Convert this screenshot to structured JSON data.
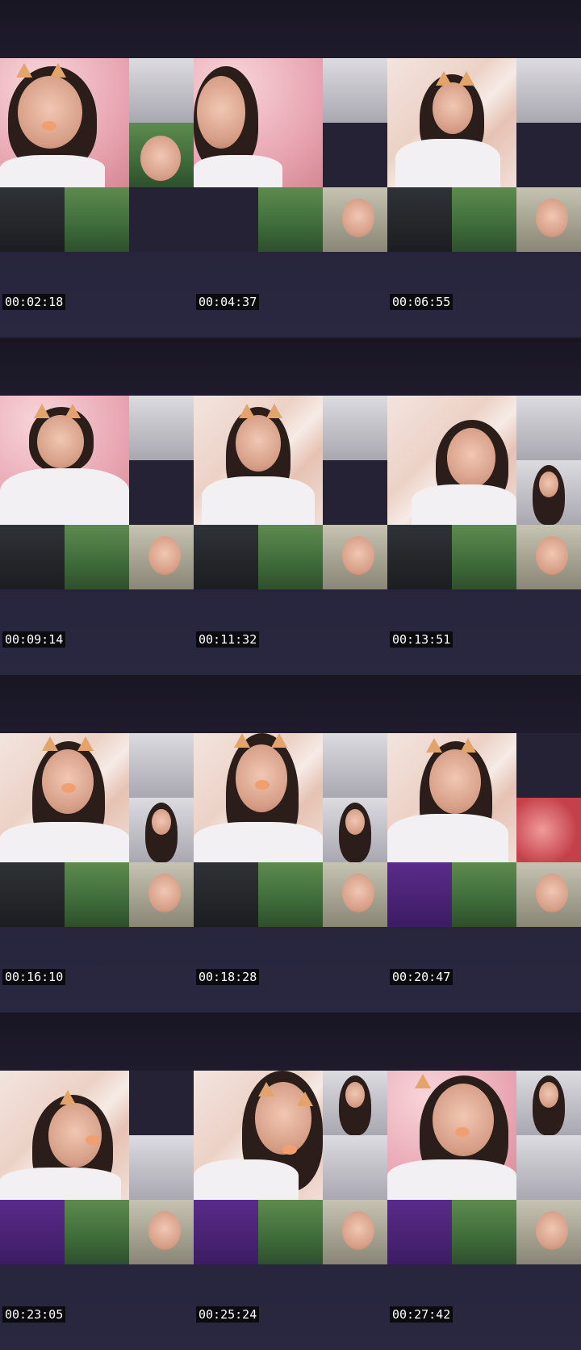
{
  "frames": [
    {
      "timestamp": "00:02:18"
    },
    {
      "timestamp": "00:04:37"
    },
    {
      "timestamp": "00:06:55"
    },
    {
      "timestamp": "00:09:14"
    },
    {
      "timestamp": "00:11:32"
    },
    {
      "timestamp": "00:13:51"
    },
    {
      "timestamp": "00:16:10"
    },
    {
      "timestamp": "00:18:28"
    },
    {
      "timestamp": "00:20:47"
    },
    {
      "timestamp": "00:23:05"
    },
    {
      "timestamp": "00:25:24"
    },
    {
      "timestamp": "00:27:42"
    }
  ],
  "colors": {
    "background": "#1c1a28",
    "timestamp_bg": "#0b0b0f",
    "timestamp_text": "#ffffff"
  }
}
